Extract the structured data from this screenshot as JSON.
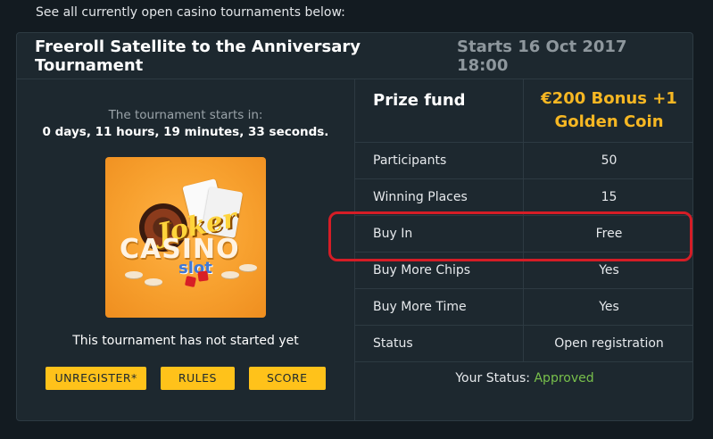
{
  "intro_text": "See all currently open casino tournaments below:",
  "tournament": {
    "title": "Freeroll Satellite to the Anniversary Tournament",
    "starts": "Starts 16 Oct 2017 18:00",
    "starts_in_label": "The tournament starts in:",
    "countdown": "0 days, 11 hours, 19 minutes, 33 seconds.",
    "logo_alt_name": "joker-casino-slot-logo",
    "status_message": "This tournament has not started yet",
    "buttons": {
      "unregister": "UNREGISTER*",
      "rules": "RULES",
      "score": "SCORE"
    },
    "prize_label": "Prize fund",
    "prize_line1": "€200 Bonus +1",
    "prize_line2": "Golden Coin",
    "details": [
      {
        "label": "Participants",
        "value": "50"
      },
      {
        "label": "Winning Places",
        "value": "15"
      },
      {
        "label": "Buy In",
        "value": "Free"
      },
      {
        "label": "Buy More Chips",
        "value": "Yes"
      },
      {
        "label": "Buy More Time",
        "value": "Yes"
      },
      {
        "label": "Status",
        "value": "Open registration"
      }
    ],
    "your_status_label": "Your Status:",
    "your_status_value": "Approved"
  },
  "colors": {
    "background": "#131b21",
    "card": "#1d282f",
    "accent_yellow": "#ffc21a",
    "prize_gold": "#f6b723",
    "approved_green": "#78c04b",
    "highlight_red": "#d51d26"
  }
}
